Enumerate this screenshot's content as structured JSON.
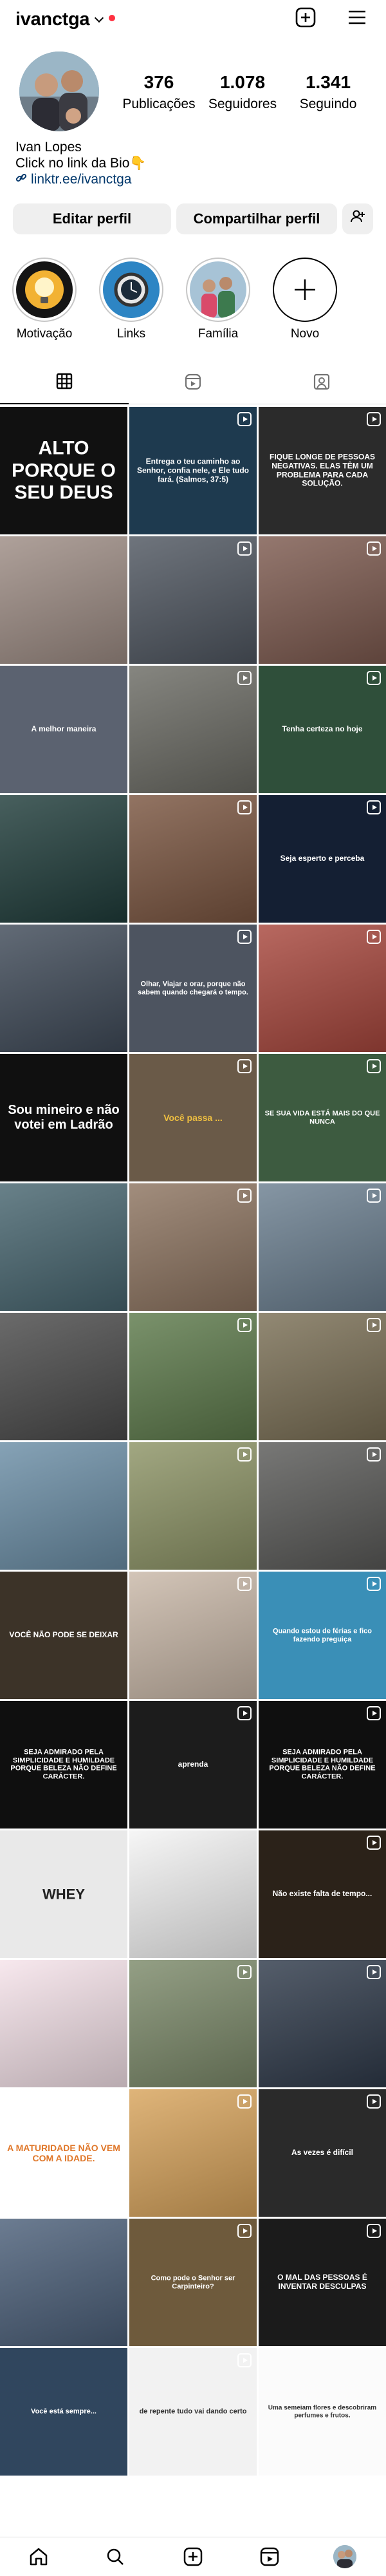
{
  "header": {
    "username": "ivanctga",
    "notification_color": "#ff3040",
    "icons": [
      "chevron-down-icon",
      "new-post-icon",
      "menu-icon"
    ]
  },
  "profile": {
    "stats": [
      {
        "value": "376",
        "label": "Publicações"
      },
      {
        "value": "1.078",
        "label": "Seguidores"
      },
      {
        "value": "1.341",
        "label": "Seguindo"
      }
    ],
    "name": "Ivan Lopes",
    "bio_line": "Click no link da Bio👇",
    "link": "linktr.ee/ivanctga"
  },
  "buttons": {
    "edit": "Editar perfil",
    "share": "Compartilhar perfil"
  },
  "highlights": [
    {
      "label": "Motivação"
    },
    {
      "label": "Links"
    },
    {
      "label": "Família"
    },
    {
      "label": "Novo"
    }
  ],
  "tabs": [
    "grid-icon",
    "reels-icon",
    "tagged-icon"
  ],
  "posts": [
    {
      "bg": "#111111",
      "text": "ALTO PORQUE O SEU DEUS",
      "color": "#ffffff",
      "size": 30
    },
    {
      "bg": "#1e3a4f",
      "text": "Entrega o teu caminho ao Senhor, confia nele, e Ele tudo fará. (Salmos, 37:5)",
      "color": "#ffffff",
      "size": 12
    },
    {
      "bg": "#2b2b2b",
      "text": "FIQUE LONGE DE PESSOAS NEGATIVAS. ELAS TÊM UM PROBLEMA PARA CADA SOLUÇÃO.",
      "color": "#ffffff",
      "size": 12
    },
    {
      "bg": "#9d8c84",
      "text": "",
      "color": "#ffffff",
      "size": 12
    },
    {
      "bg": "#4f5660",
      "text": "",
      "color": "#ffffff",
      "size": 12
    },
    {
      "bg": "#7d5a4f",
      "text": "",
      "color": "#ffffff",
      "size": 12
    },
    {
      "bg": "#5b6270",
      "text": "A melhor maneira",
      "color": "#ffffff",
      "size": 12
    },
    {
      "bg": "#6b6b64",
      "text": "",
      "color": "#ffffff",
      "size": 12
    },
    {
      "bg": "#2f4f3a",
      "text": "Tenha certeza no hoje",
      "color": "#ffffff",
      "size": 12
    },
    {
      "bg": "#1f3c3a",
      "text": "",
      "color": "#ffffff",
      "size": 12
    },
    {
      "bg": "#7a5540",
      "text": "",
      "color": "#ffffff",
      "size": 12
    },
    {
      "bg": "#141f33",
      "text": "Seja esperto e perceba",
      "color": "#ffffff",
      "size": 12
    },
    {
      "bg": "#3f4a58",
      "text": "",
      "color": "#ffffff",
      "size": 12
    },
    {
      "bg": "#4d5460",
      "text": "Olhar, Viajar e orar, porque não sabem quando chegará o tempo.",
      "color": "#ffffff",
      "size": 11
    },
    {
      "bg": "#a8473d",
      "text": "",
      "color": "#ffffff",
      "size": 12
    },
    {
      "bg": "#101010",
      "text": "Sou mineiro e não votei em Ladrão",
      "color": "#ffffff",
      "size": 20
    },
    {
      "bg": "#6a5a48",
      "text": "Você passa ...",
      "color": "#f0c040",
      "size": 14
    },
    {
      "bg": "#3d5b40",
      "text": "SE SUA VIDA ESTÁ MAIS DO QUE NUNCA",
      "color": "#ffffff",
      "size": 11
    },
    {
      "bg": "#47656f",
      "text": "",
      "color": "#ffffff",
      "size": 12
    },
    {
      "bg": "#8d7460",
      "text": "",
      "color": "#ffffff",
      "size": 12
    },
    {
      "bg": "#6b7f90",
      "text": "",
      "color": "#ffffff",
      "size": 12
    },
    {
      "bg": "#4a4a4a",
      "text": "",
      "color": "#ffffff",
      "size": 12
    },
    {
      "bg": "#5d7a4b",
      "text": "",
      "color": "#ffffff",
      "size": 12
    },
    {
      "bg": "#7a6f55",
      "text": "",
      "color": "#ffffff",
      "size": 12
    },
    {
      "bg": "#6b8ea6",
      "text": "",
      "color": "#ffffff",
      "size": 12
    },
    {
      "bg": "#8d9466",
      "text": "",
      "color": "#ffffff",
      "size": 12
    },
    {
      "bg": "#5a5a58",
      "text": "",
      "color": "#ffffff",
      "size": 12
    },
    {
      "bg": "#3c3328",
      "text": "VOCÊ NÃO PODE SE DEIXAR",
      "color": "#ffffff",
      "size": 12
    },
    {
      "bg": "#c9b8a8",
      "text": "",
      "color": "#ffffff",
      "size": 12
    },
    {
      "bg": "#3a8fb7",
      "text": "Quando estou de férias e fico fazendo preguiça",
      "color": "#ffffff",
      "size": 11
    },
    {
      "bg": "#0f0f0f",
      "text": "SEJA ADMIRADO PELA SIMPLICIDADE E HUMILDADE PORQUE BELEZA NÃO DEFINE CARÁCTER.",
      "color": "#ffffff",
      "size": 11
    },
    {
      "bg": "#1c1c1c",
      "text": "aprenda",
      "color": "#ffffff",
      "size": 12
    },
    {
      "bg": "#0f0f0f",
      "text": "SEJA ADMIRADO PELA SIMPLICIDADE E HUMILDADE PORQUE BELEZA NÃO DEFINE CARÁCTER.",
      "color": "#ffffff",
      "size": 11
    },
    {
      "bg": "#e9e9e9",
      "text": "WHEY",
      "color": "#222222",
      "size": 22
    },
    {
      "bg": "#f4f4f4",
      "text": "",
      "color": "#222222",
      "size": 12
    },
    {
      "bg": "#2b2219",
      "text": "Não existe falta de tempo...",
      "color": "#ffffff",
      "size": 12
    },
    {
      "bg": "#f6e3ea",
      "text": "",
      "color": "#222222",
      "size": 12
    },
    {
      "bg": "#7c8a6a",
      "text": "",
      "color": "#ffffff",
      "size": 12
    },
    {
      "bg": "#2f3a4a",
      "text": "",
      "color": "#ffffff",
      "size": 12
    },
    {
      "bg": "#ffffff",
      "text": "A MATURIDADE NÃO VEM COM A IDADE.",
      "color": "#e0782b",
      "size": 14
    },
    {
      "bg": "#d8a45c",
      "text": "",
      "color": "#ffffff",
      "size": 12
    },
    {
      "bg": "#2a2a2a",
      "text": "As vezes é difícil",
      "color": "#ffffff",
      "size": 12
    },
    {
      "bg": "#4b5f79",
      "text": "",
      "color": "#ffffff",
      "size": 12
    },
    {
      "bg": "#6e5a3c",
      "text": "Como pode o Senhor ser Carpinteiro?",
      "color": "#ffffff",
      "size": 11
    },
    {
      "bg": "#1b1b1b",
      "text": "O MAL DAS PESSOAS É INVENTAR DESCULPAS",
      "color": "#ffffff",
      "size": 12
    },
    {
      "bg": "#30465e",
      "text": "Você está sempre...",
      "color": "#ffffff",
      "size": 11
    },
    {
      "bg": "#f2f2f2",
      "text": "de repente tudo vai dando certo",
      "color": "#333333",
      "size": 11
    },
    {
      "bg": "#fbfbfb",
      "text": "Uma semeiam flores e descobriram perfumes e frutos.",
      "color": "#333333",
      "size": 10
    }
  ],
  "bottom_nav": [
    "home-icon",
    "search-icon",
    "create-icon",
    "reels-icon",
    "profile-avatar"
  ]
}
